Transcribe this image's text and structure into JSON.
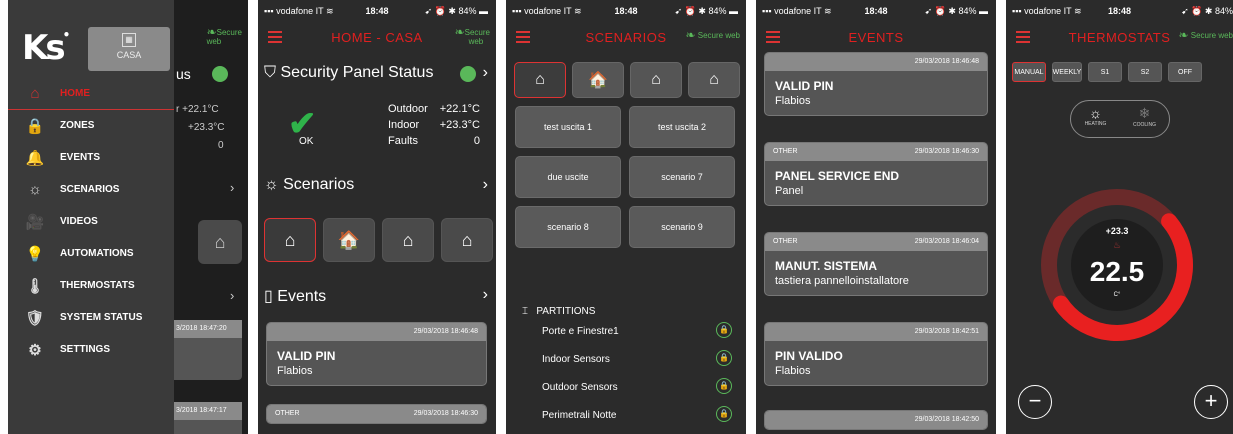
{
  "status": {
    "carrier": "vodafone IT",
    "signal_icon": "signal-icon",
    "wifi_icon": "wifi-icon",
    "time": "18:48",
    "battery": "84%"
  },
  "secure": {
    "line1": "Secure",
    "line2": "web",
    "inline": "Secure web"
  },
  "panel1": {
    "logo": "Ks",
    "logo_dot": "•",
    "casa_label": "CASA",
    "menu": [
      {
        "label": "HOME",
        "icon": "home-icon",
        "glyph": "⌂",
        "active": true
      },
      {
        "label": "ZONES",
        "icon": "lock-icon",
        "glyph": "🔒",
        "active": false
      },
      {
        "label": "EVENTS",
        "icon": "bell-icon",
        "glyph": "🔔",
        "active": false
      },
      {
        "label": "SCENARIOS",
        "icon": "sun-moon-icon",
        "glyph": "☼",
        "active": false
      },
      {
        "label": "VIDEOS",
        "icon": "camera-icon",
        "glyph": "🎥",
        "active": false
      },
      {
        "label": "AUTOMATIONS",
        "icon": "bulb-icon",
        "glyph": "💡",
        "active": false
      },
      {
        "label": "THERMOSTATS",
        "icon": "thermometer-icon",
        "glyph": "🌡",
        "active": false
      },
      {
        "label": "SYSTEM STATUS",
        "icon": "shield-icon",
        "glyph": "🛡",
        "active": false
      },
      {
        "label": "SETTINGS",
        "icon": "gear-icon",
        "glyph": "⚙",
        "active": false
      }
    ],
    "peek": {
      "us": "us",
      "temp1": "r  +22.1°C",
      "temp2": "+23.3°C",
      "zero": "0",
      "date1": "3/2018 18:47:20",
      "date2": "3/2018 18:47:17"
    }
  },
  "panel2": {
    "title": "HOME - CASA",
    "security_title": "Security Panel Status",
    "ok": "OK",
    "outdoor_label": "Outdoor",
    "outdoor_val": "+22.1°C",
    "indoor_label": "Indoor",
    "indoor_val": "+23.3°C",
    "faults_label": "Faults",
    "faults_val": "0",
    "scenarios_title": "Scenarios",
    "events_title": "Events",
    "event1": {
      "date": "29/03/2018 18:46:48",
      "title": "VALID PIN",
      "sub": "Flabios"
    },
    "event2": {
      "type": "OTHER",
      "date": "29/03/2018 18:46:30"
    }
  },
  "panel3": {
    "title": "SCENARIOS",
    "scenarios": [
      "test uscita 1",
      "test uscita 2",
      "due uscite",
      "scenario 7",
      "scenario 8",
      "scenario 9"
    ],
    "partitions_title": "PARTITIONS",
    "partitions": [
      "Porte e Finestre1",
      "Indoor Sensors",
      "Outdoor Sensors",
      "Perimetrali Notte"
    ]
  },
  "panel4": {
    "title": "EVENTS",
    "events": [
      {
        "type": "",
        "date": "29/03/2018 18:46:48",
        "title": "VALID PIN",
        "sub": "Flabios"
      },
      {
        "type": "OTHER",
        "date": "29/03/2018 18:46:30",
        "title": "PANEL SERVICE END",
        "sub": "Panel"
      },
      {
        "type": "OTHER",
        "date": "29/03/2018 18:46:04",
        "title": "MANUT. SISTEMA",
        "sub": "tastiera pannelloinstallatore"
      },
      {
        "type": "",
        "date": "29/03/2018 18:42:51",
        "title": "PIN VALIDO",
        "sub": "Flabios"
      },
      {
        "type": "",
        "date": "29/03/2018 18:42:50",
        "title": "",
        "sub": ""
      }
    ]
  },
  "panel5": {
    "title": "THERMOSTATS",
    "modes": [
      "MANUAL",
      "WEEKLY",
      "S1",
      "S2",
      "OFF"
    ],
    "heating": "HEATING",
    "cooling": "COOLING",
    "set_temp": "+23.3",
    "current_temp": "22.5",
    "unit": "C°",
    "minus": "−",
    "plus": "+"
  },
  "colors": {
    "accent": "#e02020",
    "ok_green": "#2fb34a",
    "secure_green": "#5ab85a",
    "bg": "#2b2b2b"
  }
}
